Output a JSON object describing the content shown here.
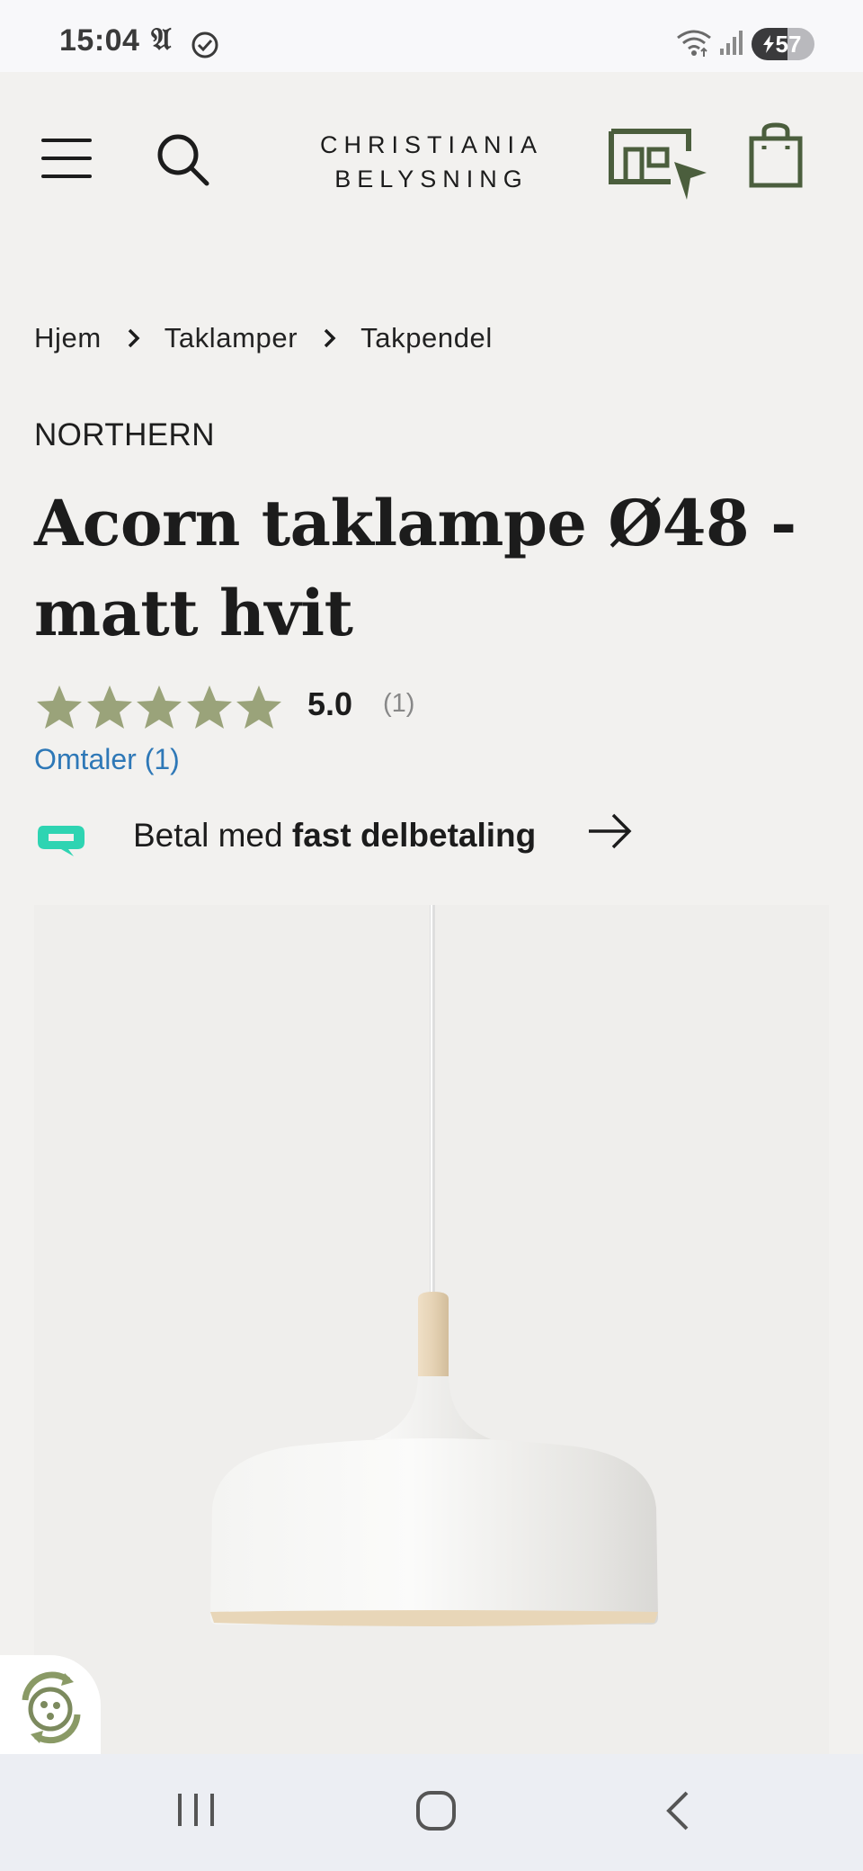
{
  "status_bar": {
    "time": "15:04",
    "app_glyph": "𝔄",
    "battery_level": "57",
    "battery_fraction": 0.57
  },
  "header": {
    "logo_line1": "CHRISTIANIA",
    "logo_line2": "BELYSNING",
    "icons": [
      "menu-icon",
      "search-icon",
      "store-icon",
      "cart-icon"
    ],
    "logo_color": "#1c1c1c",
    "icon_accent": "#4b5e3d"
  },
  "breadcrumb": {
    "items": [
      "Hjem",
      "Taklamper",
      "Takpendel"
    ]
  },
  "product": {
    "brand": "NORTHERN",
    "title_line1": "Acorn taklampe Ø48 -",
    "title_line2": "matt hvit",
    "rating_value": "5.0",
    "rating_count": "(1)",
    "stars": 5,
    "star_color": "#9aa37a",
    "reviews_link": "Omtaler (1)",
    "reviews_link_color": "#2e78b7"
  },
  "payment": {
    "text_prefix": "Betal med ",
    "text_bold": "fast delbetaling",
    "logo_color": "#2ed4b2"
  },
  "nav_bar": {
    "buttons": [
      "recents-icon",
      "home-icon",
      "back-icon"
    ]
  }
}
